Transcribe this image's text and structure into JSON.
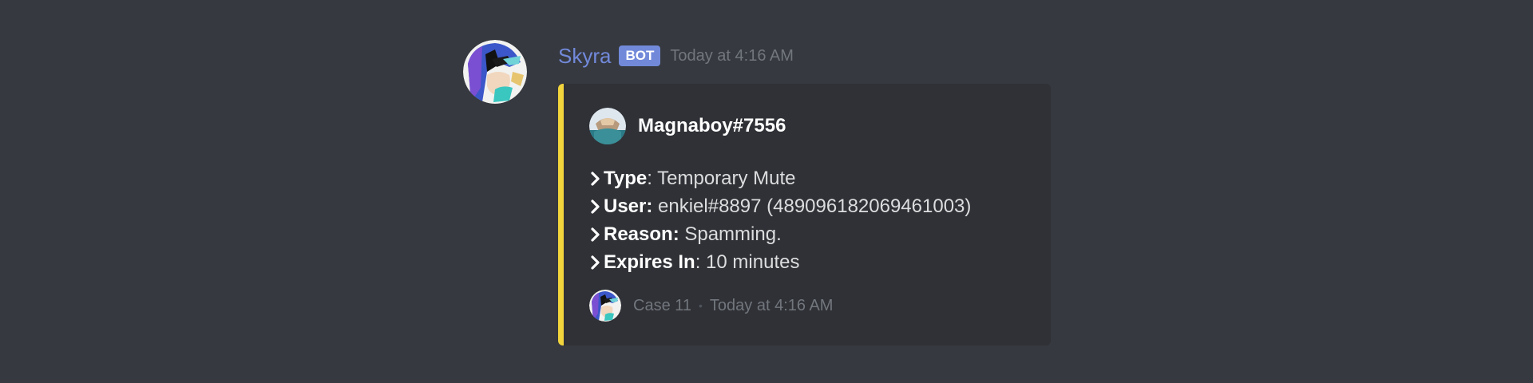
{
  "message": {
    "author": "Skyra",
    "badge": "BOT",
    "timestamp": "Today at 4:16 AM",
    "avatar_icon": "skyra-avatar-icon"
  },
  "embed": {
    "accent_color": "#f2d43d",
    "author": {
      "name": "Magnaboy#7556",
      "avatar_icon": "magnaboy-avatar-icon"
    },
    "fields": [
      {
        "key": "Type",
        "sep": ":",
        "value": " Temporary Mute"
      },
      {
        "key": "User:",
        "sep": "",
        "value": " enkiel#8897 (489096182069461003)"
      },
      {
        "key": "Reason:",
        "sep": "",
        "value": " Spamming."
      },
      {
        "key": "Expires In",
        "sep": ":",
        "value": " 10 minutes"
      }
    ],
    "footer": {
      "icon": "skyra-footer-icon",
      "text": "Case 11",
      "separator": "•",
      "timestamp": "Today at 4:16 AM"
    }
  },
  "colors": {
    "background": "#36393f",
    "embed_background": "#2f3136",
    "author_name": "#7289da",
    "badge": "#7289da",
    "muted_text": "#72767d"
  }
}
